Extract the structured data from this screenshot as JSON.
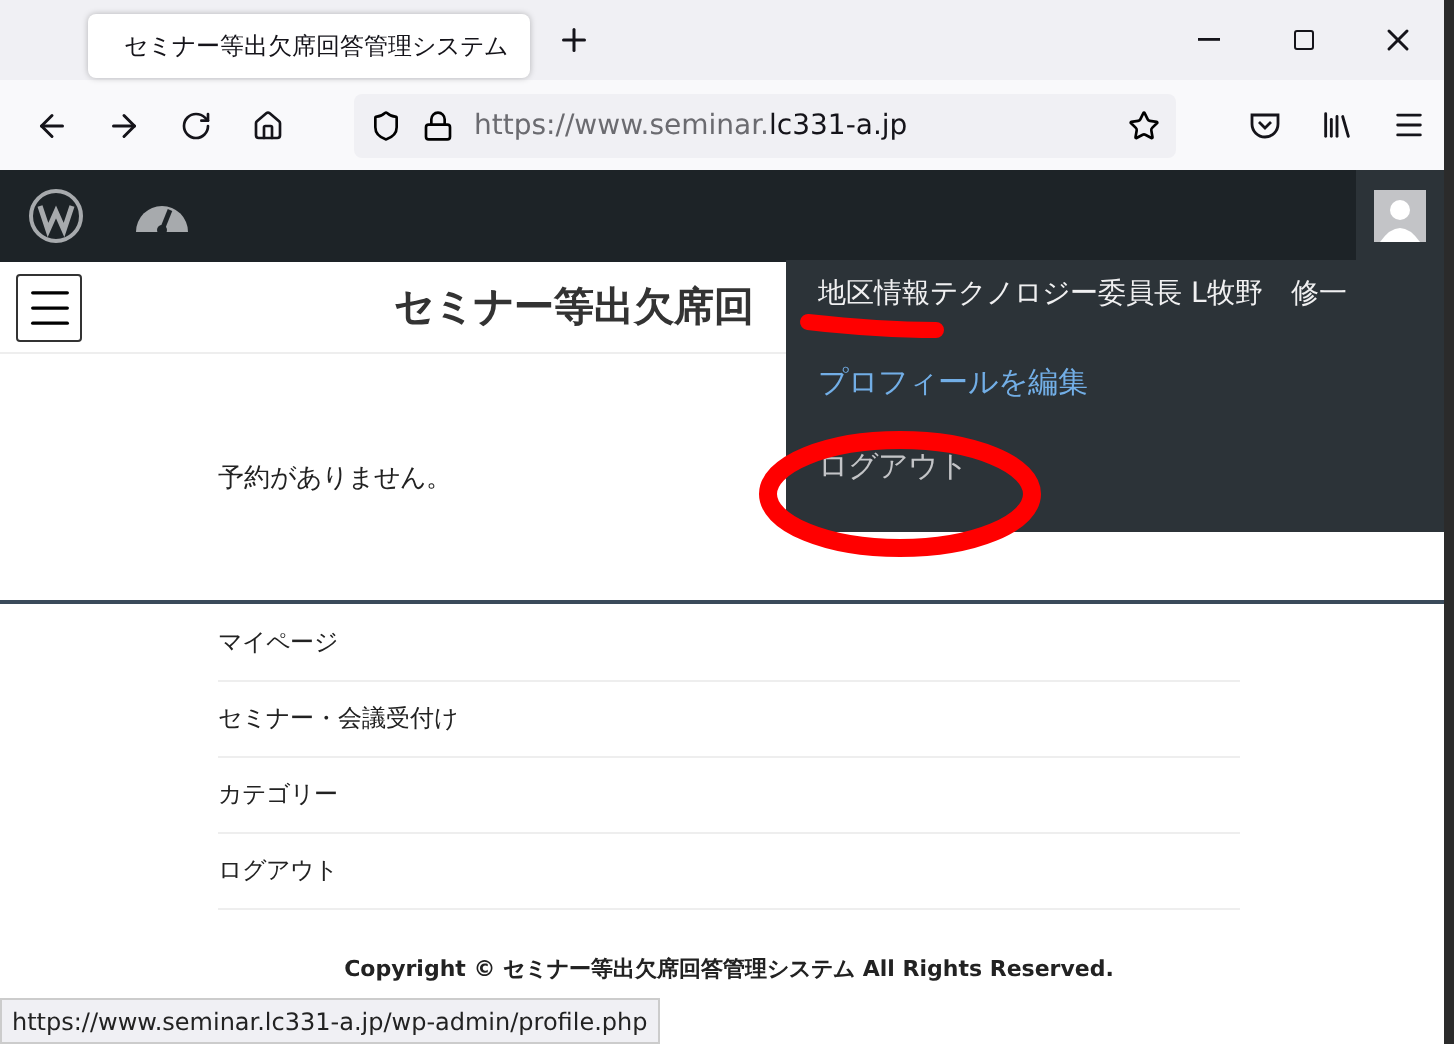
{
  "browser": {
    "tab": {
      "title": "セミナー等出欠席回答管理システム"
    },
    "url": {
      "prefix": "https://www.seminar.",
      "host": "lc331-a.jp"
    }
  },
  "admin_bar": {
    "user_menu": {
      "name": "地区情報テクノロジー委員長 L牧野　修一",
      "items": [
        {
          "label": "プロフィールを編集",
          "hovered": true
        },
        {
          "label": "ログアウト",
          "hovered": false
        }
      ]
    }
  },
  "page": {
    "site_title": "セミナー等出欠席回",
    "message": "予約がありません。",
    "footer_menu": [
      "マイページ",
      "セミナー・会議受付け",
      "カテゴリー",
      "ログアウト"
    ],
    "copyright": "Copyright © セミナー等出欠席回答管理システム All Rights Reserved."
  },
  "status_bar": {
    "link": "https://www.seminar.lc331-a.jp/wp-admin/profile.php"
  },
  "annotations": {
    "underline": true,
    "circle": true
  }
}
